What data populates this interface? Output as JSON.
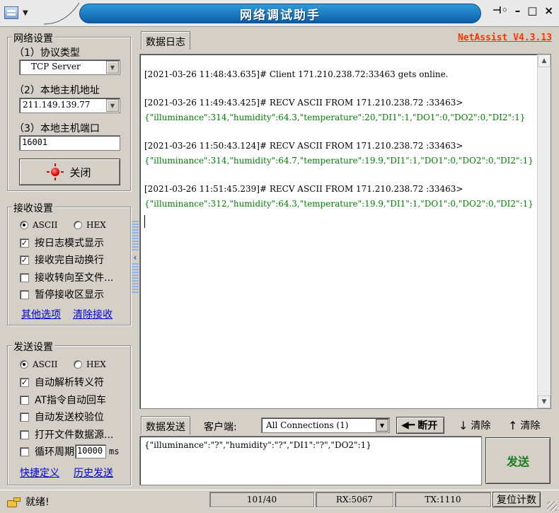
{
  "window": {
    "title": "网络调试助手",
    "version_link": "NetAssist V4.3.13",
    "controls": {
      "pin": "⊣◦",
      "minimize": "–",
      "restore": "□",
      "close": "×"
    }
  },
  "network": {
    "legend": "网络设置",
    "protocol_label": "（1）协议类型",
    "protocol_value": "TCP Server",
    "host_label": "（2）本地主机地址",
    "host_value": "211.149.139.77",
    "port_label": "（3）本地主机端口",
    "port_value": "16001",
    "close_button": "关闭"
  },
  "receive": {
    "legend": "接收设置",
    "encoding_ascii": "ASCII",
    "encoding_hex": "HEX",
    "options": [
      {
        "label": "按日志模式显示",
        "checked": true
      },
      {
        "label": "接收完自动换行",
        "checked": true
      },
      {
        "label": "接收转向至文件...",
        "checked": false
      },
      {
        "label": "暂停接收区显示",
        "checked": false
      }
    ],
    "link_more": "其他选项",
    "link_clear": "清除接收"
  },
  "send": {
    "legend": "发送设置",
    "encoding_ascii": "ASCII",
    "encoding_hex": "HEX",
    "options": [
      {
        "label": "自动解析转义符",
        "checked": true
      },
      {
        "label": "AT指令自动回车",
        "checked": false
      },
      {
        "label": "自动发送校验位",
        "checked": false
      },
      {
        "label": "打开文件数据源...",
        "checked": false
      }
    ],
    "cycle_label": "循环周期",
    "cycle_value": "10000",
    "cycle_unit": "ms",
    "link_shortcut": "快捷定义",
    "link_history": "历史发送"
  },
  "log": {
    "tab": "数据日志",
    "entries": [
      {
        "head": "[2021-03-26 11:48:43.635]# Client 171.210.238.72:33463 gets online.",
        "body": ""
      },
      {
        "head": "[2021-03-26 11:49:43.425]# RECV ASCII FROM 171.210.238.72 :33463>",
        "body": "{\"illuminance\":314,\"humidity\":64.3,\"temperature\":20,\"DI1\":1,\"DO1\":0,\"DO2\":0,\"DI2\":1}"
      },
      {
        "head": "[2021-03-26 11:50:43.124]# RECV ASCII FROM 171.210.238.72 :33463>",
        "body": "{\"illuminance\":314,\"humidity\":64.7,\"temperature\":19.9,\"DI1\":1,\"DO1\":0,\"DO2\":0,\"DI2\":1}"
      },
      {
        "head": "[2021-03-26 11:51:45.239]# RECV ASCII FROM 171.210.238.72 :33463>",
        "body": "{\"illuminance\":312,\"humidity\":64.3,\"temperature\":19.9,\"DI1\":1,\"DO1\":0,\"DO2\":0,\"DI2\":1}"
      }
    ]
  },
  "sendbar": {
    "tab": "数据发送",
    "client_label": "客户端:",
    "connections_value": "All Connections (1)",
    "disconnect_button": "断开",
    "clear_button": "清除",
    "clear2_button": "清除",
    "payload": "{\"illuminance\":\"?\",\"humidity\":\"?\",\"DI1\":\"?\",\"DO2\":1}",
    "send_button": "发送"
  },
  "status": {
    "ready": "就绪!",
    "counter": "101/40",
    "rx": "RX:5067",
    "tx": "TX:1110",
    "reset_button": "复位计数"
  },
  "colors": {
    "title_blue": "#0b5fa8",
    "recv_green": "#008000",
    "version_orange": "#ff3300",
    "send_green": "#1b7d1b"
  }
}
